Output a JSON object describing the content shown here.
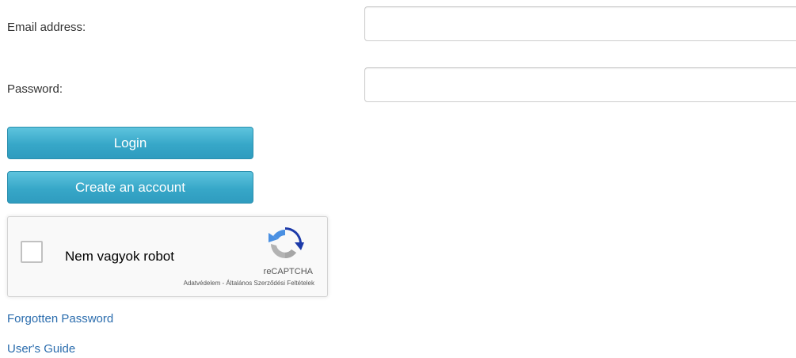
{
  "form": {
    "email_label": "Email address:",
    "email_value": "",
    "password_label": "Password:",
    "password_value": ""
  },
  "buttons": {
    "login_label": "Login",
    "create_account_label": "Create an account"
  },
  "recaptcha": {
    "checkbox_label": "Nem vagyok robot",
    "brand": "reCAPTCHA",
    "privacy_link": "Adatvédelem",
    "separator": " - ",
    "terms_link": "Általános Szerződési Feltételek",
    "checked": false,
    "logo_icon": "recaptcha-logo-icon"
  },
  "links": {
    "forgotten_password": "Forgotten Password",
    "users_guide": "User's Guide"
  },
  "colors": {
    "button_top": "#5ec4de",
    "button_bottom": "#2f9cbf",
    "link": "#2a6cad"
  }
}
